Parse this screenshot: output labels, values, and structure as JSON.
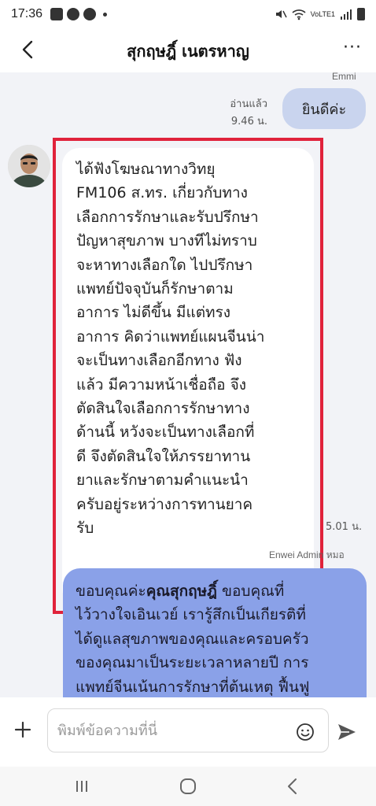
{
  "status_bar": {
    "time": "17:36",
    "network_label": "VoLTE1"
  },
  "header": {
    "title": "สุกฤษฎิ์ เนตรหาญ",
    "more_label": "···"
  },
  "chat": {
    "messages": [
      {
        "sender": "Emmi",
        "direction": "outgoing",
        "text": "ยินดีค่ะ",
        "read_label": "อ่านแล้ว",
        "time": "9.46 น."
      },
      {
        "direction": "incoming",
        "lines": [
          "ได้ฟังโฆษณาทางวิทยุ",
          "FM106 ส.ทร. เกี่ยวกับทาง",
          "เลือกการรักษาและรับปรึกษา",
          "ปัญหาสุขภาพ บางทีไม่ทราบ",
          "จะหาทางเลือกใด ไปปรึกษา",
          "แพทย์ปัจจุบันก็รักษาตาม",
          "อาการ ไม่ดีขึ้น มีแต่ทรง",
          "อาการ คิดว่าแพทย์แผนจีนน่า",
          "จะเป็นทางเลือกอีกทาง ฟัง",
          "แล้ว มีความหน้าเชื่อถือ จึง",
          "ตัดสินใจเลือกการรักษาทาง",
          "ด้านนี้ หวังจะเป็นทางเลือกที่",
          "ดี จึงตัดสินใจให้ภรรยาทาน",
          "ยาและรักษาตามคำแนะนำ",
          "ครับอยู่ระหว่างการทานยาค",
          "รับ"
        ],
        "time": "5.01 น."
      },
      {
        "sender": "Enwei Admin หมอ",
        "direction": "outgoing",
        "line1_prefix": "ขอบคุณค่ะ",
        "line1_bold": "คุณสุกฤษฎิ์",
        "line1_suffix": " ขอบคุณที่",
        "lines": [
          "ไว้วางใจเอินเวย์ เรารู้สึกเป็นเกียรติที่",
          "ได้ดูแลสุขภาพของคุณและครอบครัว",
          "ของคุณมาเป็นระยะเวลาหลายปี การ",
          "แพทย์จีนเน้นการรักษาที่ต้นเหตุ ฟื้นฟู"
        ]
      }
    ]
  },
  "input": {
    "placeholder": "พิมพ์ข้อความที่นี่"
  },
  "colors": {
    "outgoing_light": "#c9d4ee",
    "outgoing_blue": "#8aa1e8",
    "highlight": "#e0223b",
    "chat_background": "#f2f3f7"
  },
  "icons": {
    "back": "chevron-left-icon",
    "add": "plus-icon",
    "emoji": "smiley-icon",
    "send": "send-icon",
    "nav_recents": "recents-icon",
    "nav_home": "home-icon",
    "nav_back": "chevron-left-icon"
  }
}
